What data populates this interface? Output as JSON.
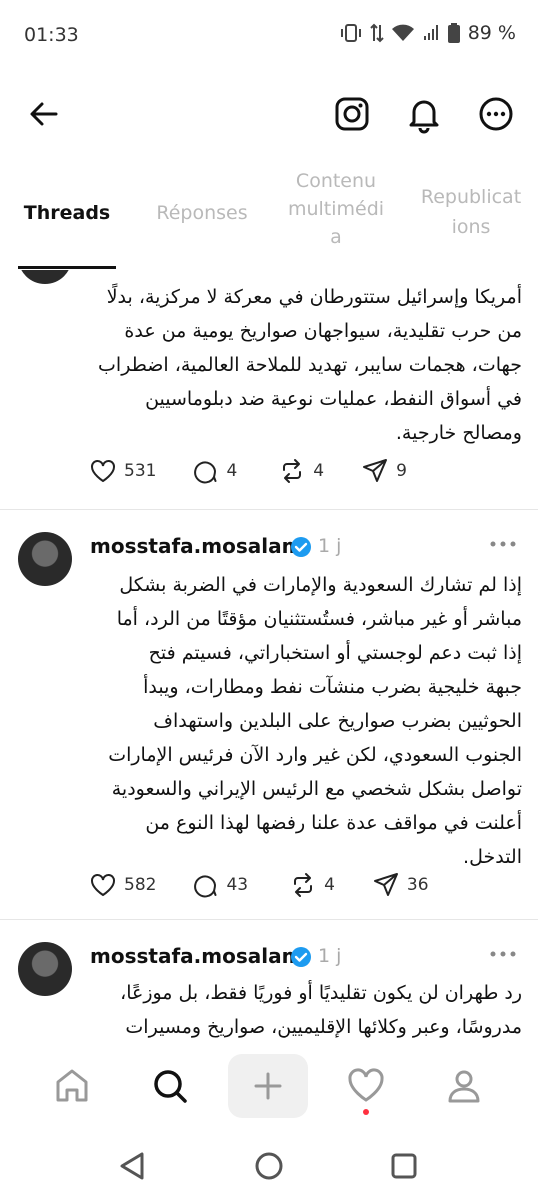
{
  "status_bar": {
    "time": "01:33",
    "battery": "89 %"
  },
  "header": {
    "back_icon": "arrow-left-icon",
    "icons": [
      "instagram-icon",
      "bell-icon",
      "more-circle-icon"
    ]
  },
  "tabs": [
    {
      "label": "Threads",
      "active": true
    },
    {
      "label": "Réponses",
      "active": false
    },
    {
      "label": "Contenu multimédia",
      "active": false
    },
    {
      "label": "Republications",
      "active": false
    }
  ],
  "tab_lines": {
    "tab3": [
      "Contenu",
      "multimédi",
      "a"
    ],
    "tab4": [
      "Republicat",
      "ions"
    ]
  },
  "posts": [
    {
      "partial": true,
      "text_lines": [
        "أمريكا وإسرائيل ستتورطان في معركة لا مركزية، بدلًا",
        "من حرب تقليدية، سيواجهان صواريخ يومية من عدة",
        "جهات، هجمات سايبر، تهديد للملاحة العالمية، اضطراب",
        "في أسواق النفط، عمليات نوعية ضد دبلوماسيين",
        "ومصالح خارجية."
      ],
      "likes": "531",
      "replies": "4",
      "reposts": "4",
      "shares": "9"
    },
    {
      "username": "mosstafa.mosalam",
      "age": "1 j",
      "text_lines": [
        "إذا لم تشارك السعودية والإمارات في الضربة بشكل",
        "مباشر أو غير مباشر، فستُستثنيان مؤقتًا من الرد، أما",
        "إذا ثبت دعم لوجستي أو استخباراتي، فسيتم فتح",
        "جبهة خليجية بضرب منشآت نفط ومطارات، ويبدأ",
        "الحوثيين بضرب صواريخ على البلدين واستهداف",
        "الجنوب السعودي، لكن غير وارد الآن فرئيس الإمارات",
        "تواصل بشكل شخصي مع الرئيس الإيراني والسعودية",
        "أعلنت في مواقف عدة علنا رفضها لهذا النوع من",
        "التدخل."
      ],
      "likes": "582",
      "replies": "43",
      "reposts": "4",
      "shares": "36"
    },
    {
      "username": "mosstafa.mosalam",
      "age": "1 j",
      "text_lines": [
        "رد طهران لن يكون تقليديًا أو فوريًا فقط، بل موزعًا،",
        "مدروسًا، وعبر وكلائها الإقليميين، صواريخ ومسيرات"
      ]
    }
  ],
  "bottom_nav": [
    "home-icon",
    "search-icon",
    "plus-icon",
    "heart-icon",
    "profile-icon"
  ],
  "system_nav": [
    "back-triangle-icon",
    "home-circle-icon",
    "recents-square-icon"
  ],
  "colors": {
    "verified": "#1d9bf0",
    "notification_dot": "#ff3040",
    "inactive_tab": "#b9b9b9"
  }
}
